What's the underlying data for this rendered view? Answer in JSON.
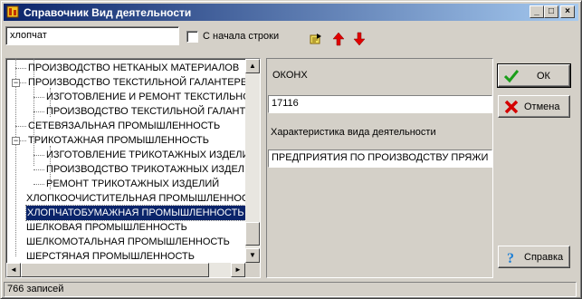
{
  "window": {
    "title": "Справочник Вид деятельности",
    "caption_buttons": [
      "_",
      "□",
      "×"
    ]
  },
  "toolbar": {
    "search_value": "хлопчат",
    "match_start_label": "С начала строки",
    "match_start_checked": false,
    "icons": [
      "find-icon",
      "arrow-up-icon",
      "arrow-down-icon"
    ]
  },
  "tree": {
    "nodes": [
      {
        "label": "ПРОИЗВОДСТВО НЕТКАНЫХ МАТЕРИАЛОВ",
        "level": 1,
        "expander": "",
        "selected": false
      },
      {
        "label": "ПРОИЗВОДСТВО ТЕКСТИЛЬНОЙ ГАЛАНТЕРЕ",
        "level": 1,
        "expander": "−",
        "selected": false
      },
      {
        "label": "ИЗГОТОВЛЕНИЕ И РЕМОНТ ТЕКСТИЛЬНО",
        "level": 2,
        "expander": "",
        "selected": false
      },
      {
        "label": "ПРОИЗВОДСТВО ТЕКСТИЛЬНОЙ ГАЛАНТ",
        "level": 2,
        "expander": "",
        "selected": false
      },
      {
        "label": "СЕТЕВЯЗАЛЬНАЯ ПРОМЫШЛЕННОСТЬ",
        "level": 1,
        "expander": "",
        "selected": false
      },
      {
        "label": "ТРИКОТАЖНАЯ ПРОМЫШЛЕННОСТЬ",
        "level": 1,
        "expander": "−",
        "selected": false
      },
      {
        "label": "ИЗГОТОВЛЕНИЕ ТРИКОТАЖНЫХ ИЗДЕЛИ",
        "level": 2,
        "expander": "",
        "selected": false
      },
      {
        "label": "ПРОИЗВОДСТВО ТРИКОТАЖНЫХ ИЗДЕЛ",
        "level": 2,
        "expander": "",
        "selected": false
      },
      {
        "label": "РЕМОНТ ТРИКОТАЖНЫХ ИЗДЕЛИЙ",
        "level": 2,
        "expander": "",
        "selected": false
      },
      {
        "label": "ХЛОПКООЧИСТИТЕЛЬНАЯ ПРОМЫШЛЕННОС",
        "level": 0,
        "expander": "",
        "selected": false
      },
      {
        "label": "ХЛОПЧАТОБУМАЖНАЯ ПРОМЫШЛЕННОСТЬ",
        "level": 0,
        "expander": "",
        "selected": true
      },
      {
        "label": "ШЕЛКОВАЯ ПРОМЫШЛЕННОСТЬ",
        "level": 0,
        "expander": "",
        "selected": false
      },
      {
        "label": "ШЕЛКОМОТАЛЬНАЯ ПРОМЫШЛЕННОСТЬ",
        "level": 0,
        "expander": "",
        "selected": false
      },
      {
        "label": "ШЕРСТЯНАЯ ПРОМЫШЛЕННОСТЬ",
        "level": 0,
        "expander": "",
        "selected": false
      }
    ]
  },
  "details": {
    "okonh_label": "ОКОНХ",
    "okonh_value": "17116",
    "characteristic_label": "Характеристика вида деятельности",
    "characteristic_value": "ПРЕДПРИЯТИЯ ПО ПРОИЗВОДСТВУ ПРЯЖИ"
  },
  "buttons": {
    "ok": "ОК",
    "cancel": "Отмена",
    "help": "Справка"
  },
  "status": {
    "records": "766 записей"
  },
  "colors": {
    "title_start": "#0a246a",
    "title_end": "#a6caf0",
    "selection": "#0a246a",
    "arrow_red": "#e00000",
    "ok_green": "#1a9e1a",
    "cancel_red": "#d40000",
    "help_blue": "#1e7fd6"
  }
}
